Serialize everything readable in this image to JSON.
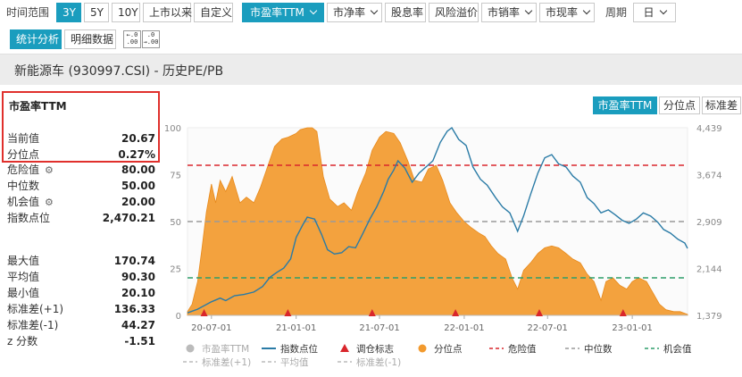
{
  "toolbar": {
    "range_label": "时间范围",
    "ranges": [
      "3Y",
      "5Y",
      "10Y",
      "上市以来",
      "自定义"
    ],
    "active_range": "3Y",
    "metrics": [
      "市盈率TTM",
      "市净率",
      "股息率",
      "风险溢价",
      "市销率",
      "市现率"
    ],
    "active_metric": "市盈率TTM",
    "period_label": "周期",
    "period_value": "日",
    "view_tabs": [
      "统计分析",
      "明细数据"
    ],
    "active_view": "统计分析"
  },
  "header": {
    "title": "新能源车 (930997.CSI) - 历史PE/PB"
  },
  "stats": {
    "heading": "市盈率TTM",
    "current_value_label": "当前值",
    "current_value": "20.67",
    "percentile_label": "分位点",
    "percentile": "0.27%",
    "danger_label": "危险值",
    "danger": "80.00",
    "median_label": "中位数",
    "median": "50.00",
    "opportunity_label": "机会值",
    "opportunity": "20.00",
    "index_label": "指数点位",
    "index": "2,470.21",
    "max_label": "最大值",
    "max": "170.74",
    "mean_label": "平均值",
    "mean": "90.30",
    "min_label": "最小值",
    "min": "20.10",
    "plus_std_label": "标准差(+1)",
    "plus_std": "136.33",
    "minus_std_label": "标准差(-1)",
    "minus_std": "44.27",
    "z_label": "z 分数",
    "z": "-1.51"
  },
  "chart_tabs": [
    "市盈率TTM",
    "分位点",
    "标准差"
  ],
  "active_chart_tab": "市盈率TTM",
  "colors": {
    "accent": "#1a9dbe",
    "area": "#f29a2e",
    "index_line": "#2a7ba6",
    "danger": "#d9262c",
    "median": "#9a9a9a",
    "opportunity": "#2e9e6b",
    "highlight_box": "#e0302c"
  },
  "chart_data": {
    "type": "area",
    "x_ticks": [
      "20-07-01",
      "21-01-01",
      "21-07-01",
      "22-01-01",
      "22-07-01",
      "23-01-01"
    ],
    "y_left_ticks": [
      0,
      25,
      50,
      75,
      100
    ],
    "y_left_range": [
      0,
      100
    ],
    "y_right_ticks": [
      "1,379",
      "2,144",
      "2,909",
      "3,674",
      "4,439"
    ],
    "y_right_range": [
      1379,
      4439
    ],
    "reference_lines": {
      "danger": 80,
      "median": 50,
      "opportunity": 20
    },
    "rebalance_markers": [
      "2020-06-15",
      "2020-12-14",
      "2021-06-15",
      "2021-12-13",
      "2022-06-13",
      "2022-12-12"
    ],
    "series": [
      {
        "name": "分位点",
        "points": [
          [
            "2020-05-10",
            2
          ],
          [
            "2020-05-20",
            6
          ],
          [
            "2020-06-01",
            18
          ],
          [
            "2020-06-10",
            35
          ],
          [
            "2020-06-20",
            55
          ],
          [
            "2020-07-01",
            70
          ],
          [
            "2020-07-10",
            60
          ],
          [
            "2020-07-20",
            72
          ],
          [
            "2020-08-01",
            66
          ],
          [
            "2020-08-15",
            74
          ],
          [
            "2020-09-01",
            60
          ],
          [
            "2020-09-15",
            63
          ],
          [
            "2020-10-01",
            60
          ],
          [
            "2020-10-15",
            68
          ],
          [
            "2020-11-01",
            80
          ],
          [
            "2020-11-15",
            90
          ],
          [
            "2020-12-01",
            94
          ],
          [
            "2020-12-15",
            95
          ],
          [
            "2021-01-01",
            97
          ],
          [
            "2021-01-10",
            99
          ],
          [
            "2021-01-25",
            100
          ],
          [
            "2021-02-05",
            100
          ],
          [
            "2021-02-15",
            98
          ],
          [
            "2021-03-01",
            74
          ],
          [
            "2021-03-15",
            62
          ],
          [
            "2021-04-01",
            58
          ],
          [
            "2021-04-15",
            60
          ],
          [
            "2021-05-01",
            56
          ],
          [
            "2021-05-15",
            66
          ],
          [
            "2021-06-01",
            76
          ],
          [
            "2021-06-15",
            88
          ],
          [
            "2021-07-01",
            95
          ],
          [
            "2021-07-15",
            98
          ],
          [
            "2021-08-01",
            97
          ],
          [
            "2021-08-15",
            92
          ],
          [
            "2021-09-01",
            82
          ],
          [
            "2021-09-15",
            72
          ],
          [
            "2021-10-01",
            71
          ],
          [
            "2021-10-15",
            78
          ],
          [
            "2021-11-01",
            80
          ],
          [
            "2021-11-15",
            72
          ],
          [
            "2021-12-01",
            60
          ],
          [
            "2021-12-15",
            55
          ],
          [
            "2022-01-01",
            50
          ],
          [
            "2022-01-15",
            47
          ],
          [
            "2022-02-01",
            44
          ],
          [
            "2022-02-15",
            42
          ],
          [
            "2022-03-01",
            37
          ],
          [
            "2022-03-15",
            33
          ],
          [
            "2022-04-01",
            30
          ],
          [
            "2022-04-15",
            20
          ],
          [
            "2022-04-27",
            14
          ],
          [
            "2022-05-10",
            24
          ],
          [
            "2022-05-25",
            28
          ],
          [
            "2022-06-10",
            33
          ],
          [
            "2022-06-25",
            36
          ],
          [
            "2022-07-10",
            37
          ],
          [
            "2022-07-25",
            36
          ],
          [
            "2022-08-10",
            33
          ],
          [
            "2022-08-25",
            30
          ],
          [
            "2022-09-10",
            28
          ],
          [
            "2022-09-25",
            22
          ],
          [
            "2022-10-10",
            18
          ],
          [
            "2022-10-25",
            8
          ],
          [
            "2022-11-05",
            18
          ],
          [
            "2022-11-20",
            20
          ],
          [
            "2022-12-05",
            16
          ],
          [
            "2022-12-20",
            14
          ],
          [
            "2023-01-01",
            18
          ],
          [
            "2023-01-15",
            20
          ],
          [
            "2023-02-01",
            18
          ],
          [
            "2023-02-15",
            12
          ],
          [
            "2023-03-01",
            6
          ],
          [
            "2023-03-15",
            3
          ],
          [
            "2023-04-01",
            2
          ],
          [
            "2023-04-15",
            2
          ],
          [
            "2023-05-01",
            0.5
          ]
        ]
      },
      {
        "name": "指数点位",
        "points": [
          [
            "2020-05-10",
            1420
          ],
          [
            "2020-06-01",
            1480
          ],
          [
            "2020-07-01",
            1600
          ],
          [
            "2020-07-20",
            1660
          ],
          [
            "2020-08-01",
            1620
          ],
          [
            "2020-08-20",
            1700
          ],
          [
            "2020-09-10",
            1720
          ],
          [
            "2020-10-01",
            1760
          ],
          [
            "2020-10-20",
            1850
          ],
          [
            "2020-11-05",
            2000
          ],
          [
            "2020-11-20",
            2080
          ],
          [
            "2020-12-05",
            2150
          ],
          [
            "2020-12-20",
            2300
          ],
          [
            "2021-01-01",
            2650
          ],
          [
            "2021-01-15",
            2850
          ],
          [
            "2021-01-25",
            2980
          ],
          [
            "2021-02-10",
            2950
          ],
          [
            "2021-02-25",
            2700
          ],
          [
            "2021-03-10",
            2450
          ],
          [
            "2021-03-25",
            2380
          ],
          [
            "2021-04-10",
            2400
          ],
          [
            "2021-04-25",
            2500
          ],
          [
            "2021-05-10",
            2480
          ],
          [
            "2021-05-25",
            2700
          ],
          [
            "2021-06-10",
            2950
          ],
          [
            "2021-06-25",
            3150
          ],
          [
            "2021-07-10",
            3400
          ],
          [
            "2021-07-20",
            3600
          ],
          [
            "2021-08-01",
            3750
          ],
          [
            "2021-08-10",
            3900
          ],
          [
            "2021-08-25",
            3780
          ],
          [
            "2021-09-10",
            3550
          ],
          [
            "2021-09-25",
            3700
          ],
          [
            "2021-10-10",
            3800
          ],
          [
            "2021-10-25",
            3900
          ],
          [
            "2021-11-10",
            4200
          ],
          [
            "2021-11-25",
            4380
          ],
          [
            "2021-12-05",
            4439
          ],
          [
            "2021-12-20",
            4250
          ],
          [
            "2022-01-05",
            4150
          ],
          [
            "2022-01-20",
            3800
          ],
          [
            "2022-02-05",
            3600
          ],
          [
            "2022-02-20",
            3500
          ],
          [
            "2022-03-10",
            3300
          ],
          [
            "2022-03-25",
            3150
          ],
          [
            "2022-04-10",
            3050
          ],
          [
            "2022-04-27",
            2750
          ],
          [
            "2022-05-10",
            3000
          ],
          [
            "2022-05-25",
            3350
          ],
          [
            "2022-06-10",
            3700
          ],
          [
            "2022-06-25",
            3950
          ],
          [
            "2022-07-10",
            4000
          ],
          [
            "2022-07-25",
            3850
          ],
          [
            "2022-08-10",
            3800
          ],
          [
            "2022-08-25",
            3650
          ],
          [
            "2022-09-10",
            3550
          ],
          [
            "2022-09-25",
            3300
          ],
          [
            "2022-10-10",
            3200
          ],
          [
            "2022-10-25",
            3050
          ],
          [
            "2022-11-10",
            3100
          ],
          [
            "2022-11-25",
            3020
          ],
          [
            "2022-12-10",
            2930
          ],
          [
            "2022-12-25",
            2880
          ],
          [
            "2023-01-10",
            2950
          ],
          [
            "2023-01-25",
            3050
          ],
          [
            "2023-02-10",
            3000
          ],
          [
            "2023-02-25",
            2900
          ],
          [
            "2023-03-10",
            2780
          ],
          [
            "2023-03-25",
            2720
          ],
          [
            "2023-04-10",
            2620
          ],
          [
            "2023-04-25",
            2560
          ],
          [
            "2023-05-01",
            2470
          ]
        ]
      }
    ],
    "legend": [
      {
        "label": "市盈率TTM",
        "kind": "dot",
        "color": "#bbbbbb",
        "active": false
      },
      {
        "label": "指数点位",
        "kind": "line",
        "color": "#2a7ba6",
        "active": true
      },
      {
        "label": "调仓标志",
        "kind": "triangle",
        "color": "#d9262c",
        "active": true
      },
      {
        "label": "分位点",
        "kind": "dot",
        "color": "#f29a2e",
        "active": true
      },
      {
        "label": "危险值",
        "kind": "dash",
        "color": "#d9262c",
        "active": true
      },
      {
        "label": "中位数",
        "kind": "dash",
        "color": "#9a9a9a",
        "active": true
      },
      {
        "label": "机会值",
        "kind": "dash",
        "color": "#2e9e6b",
        "active": true
      },
      {
        "label": "标准差(+1)",
        "kind": "dash",
        "color": "#bbbbbb",
        "active": false
      },
      {
        "label": "平均值",
        "kind": "dash",
        "color": "#bbbbbb",
        "active": false
      },
      {
        "label": "标准差(-1)",
        "kind": "dash",
        "color": "#bbbbbb",
        "active": false
      }
    ],
    "legend_position": "bottom"
  }
}
